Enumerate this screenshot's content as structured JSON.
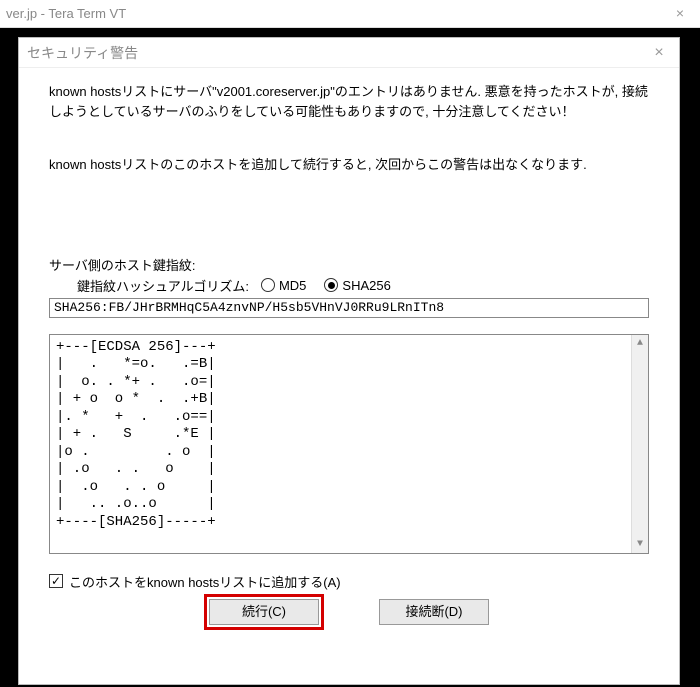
{
  "parent_window": {
    "title_fragment": "ver.jp - Tera Term VT"
  },
  "dialog": {
    "title": "セキュリティ警告",
    "message1": "known hostsリストにサーバ\"v2001.coreserver.jp\"のエントリはありません. 悪意を持ったホストが, 接続しようとしているサーバのふりをしている可能性もありますので, 十分注意してください！",
    "message2": "known hostsリストのこのホストを追加して続行すると, 次回からこの警告は出なくなります.",
    "fingerprint_section_label": "サーバ側のホスト鍵指紋:",
    "algo_label": "鍵指紋ハッシュアルゴリズム:",
    "algo_options": {
      "md5": {
        "label": "MD5",
        "selected": false
      },
      "sha256": {
        "label": "SHA256",
        "selected": true
      }
    },
    "fingerprint_value": "SHA256:FB/JHrBRMHqC5A4znvNP/H5sb5VHnVJ0RRu9LRnITn8",
    "ascii_art": "+---[ECDSA 256]---+\n|   .   *=o.   .=B|\n|  o. . *+ .   .o=|\n| + o  o *  .  .+B|\n|. *   +  .   .o==|\n| + .   S     .*E |\n|o .         . o  |\n| .o   . .   o    |\n|  .o   . . o     |\n|   .. .o..o      |\n+----[SHA256]-----+",
    "checkbox": {
      "label": "このホストをknown hostsリストに追加する(A)",
      "checked": true
    },
    "buttons": {
      "continue": "続行(C)",
      "disconnect": "接続断(D)"
    }
  }
}
